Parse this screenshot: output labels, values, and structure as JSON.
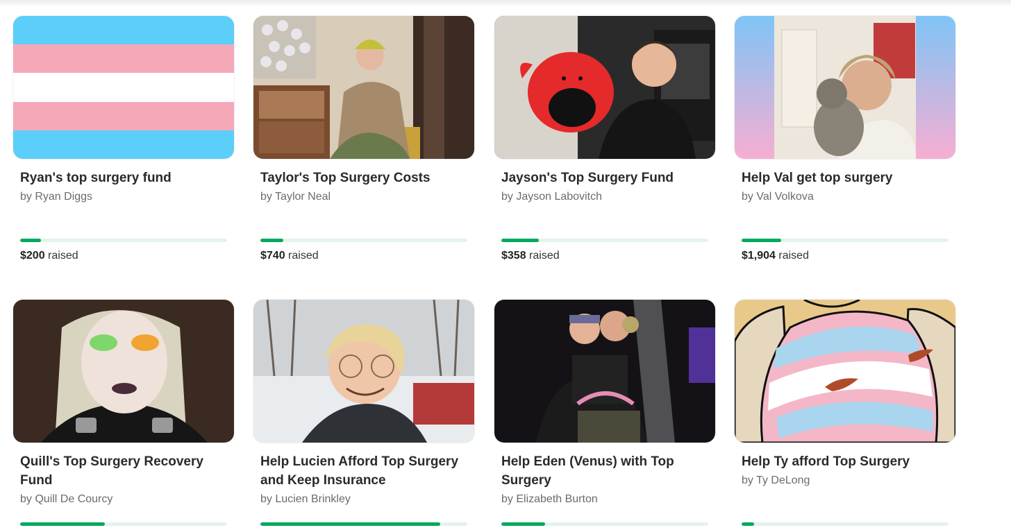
{
  "theme": {
    "progress_color": "#02a95c",
    "progress_track": "#e4f3ec",
    "trans_blue": "#5bcefa",
    "trans_pink": "#f5a9b8"
  },
  "fundraisers": [
    {
      "title": "Ryan's top surgery fund",
      "organizer": "by Ryan Diggs",
      "amount": "$200",
      "raised_suffix": "raised",
      "progress": 0.1,
      "image": "trans-flag"
    },
    {
      "title": "Taylor's Top Surgery Costs",
      "organizer": "by Taylor Neal",
      "amount": "$740",
      "raised_suffix": "raised",
      "progress": 0.11,
      "image": "photo-person-sitting-record-shelf"
    },
    {
      "title": "Jayson's Top Surgery Fund",
      "organizer": "by Jayson Labovitch",
      "amount": "$358",
      "raised_suffix": "raised",
      "progress": 0.18,
      "image": "photo-person-with-red-plush"
    },
    {
      "title": "Help Val get top surgery",
      "organizer": "by Val Volkova",
      "amount": "$1,904",
      "raised_suffix": "raised",
      "progress": 0.19,
      "image": "photo-person-with-cat"
    },
    {
      "title": "Quill's Top Surgery Recovery Fund",
      "organizer": "by Quill De Courcy",
      "progress": 0.41,
      "image": "photo-person-rainbow-makeup"
    },
    {
      "title": "Help Lucien Afford Top Surgery and Keep Insurance",
      "organizer": "by Lucien Brinkley",
      "progress": 0.87,
      "image": "photo-person-in-snow"
    },
    {
      "title": "Help Eden (Venus) with Top Surgery",
      "organizer": "by Elizabeth Burton",
      "progress": 0.21,
      "image": "photo-two-people-concert"
    },
    {
      "title": "Help Ty afford Top Surgery",
      "organizer": "by Ty DeLong",
      "progress": 0.06,
      "image": "illustration-trans-shirt"
    }
  ]
}
